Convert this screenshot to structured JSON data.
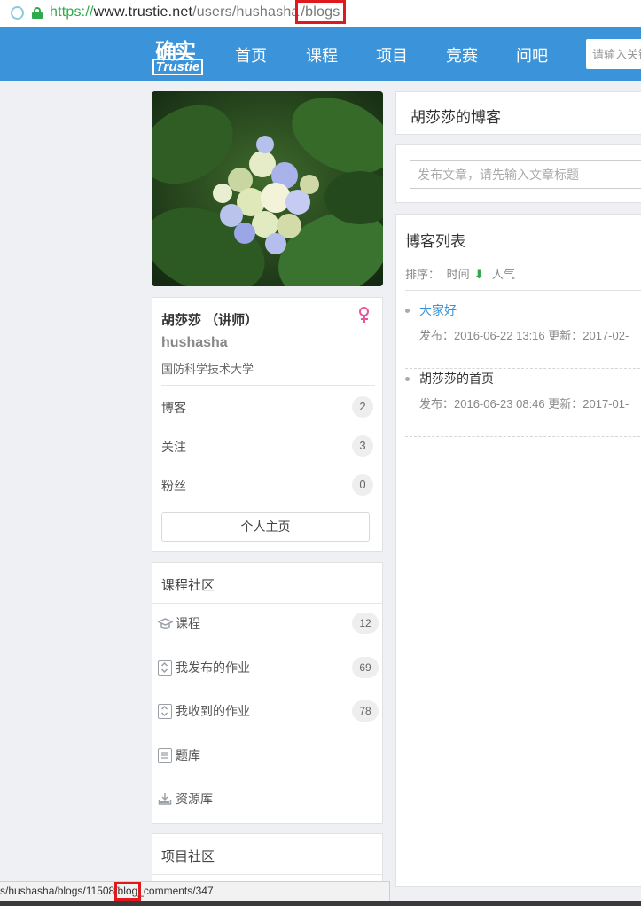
{
  "browser": {
    "url_scheme": "https://",
    "url_host": "www.trustie.net",
    "url_path": "/users/hushasha",
    "url_highlight": "/blogs"
  },
  "nav": {
    "logo_top": "确实",
    "logo_bottom": "Trustie",
    "items": [
      "首页",
      "课程",
      "项目",
      "竞赛",
      "问吧"
    ],
    "search_placeholder": "请输入关键"
  },
  "profile": {
    "name": "胡莎莎 （讲师）",
    "login": "hushasha",
    "school": "国防科学技术大学",
    "stats": [
      {
        "label": "博客",
        "count": "2"
      },
      {
        "label": "关注",
        "count": "3"
      },
      {
        "label": "粉丝",
        "count": "0"
      }
    ],
    "home_button": "个人主页"
  },
  "course_community": {
    "title": "课程社区",
    "items": [
      {
        "label": "课程",
        "count": "12",
        "icon": "graduation-cap-icon"
      },
      {
        "label": "我发布的作业",
        "count": "69",
        "icon": "homework-icon"
      },
      {
        "label": "我收到的作业",
        "count": "78",
        "icon": "homework-icon"
      },
      {
        "label": "题库",
        "count": "",
        "icon": "document-icon"
      },
      {
        "label": "资源库",
        "count": "",
        "icon": "download-tray-icon"
      }
    ]
  },
  "project_community": {
    "title": "项目社区"
  },
  "blog": {
    "header_title": "胡莎莎的博客",
    "new_post_placeholder": "发布文章，请先输入文章标题",
    "list_title": "博客列表",
    "sort_label": "排序：",
    "sort_time": "时间",
    "sort_popularity": "人气",
    "posts": [
      {
        "title": "大家好",
        "meta": "发布：2016-06-22 13:16 更新：2017-02-",
        "color": "#3b94d9"
      },
      {
        "title": "胡莎莎的首页",
        "meta": "发布：2016-06-23 08:46 更新：2017-01-",
        "color": "#333333"
      }
    ]
  },
  "status_bar": {
    "prefix": "s/hushasha/blogs/11508/",
    "highlight": "blog",
    "suffix": "_comments/347"
  }
}
